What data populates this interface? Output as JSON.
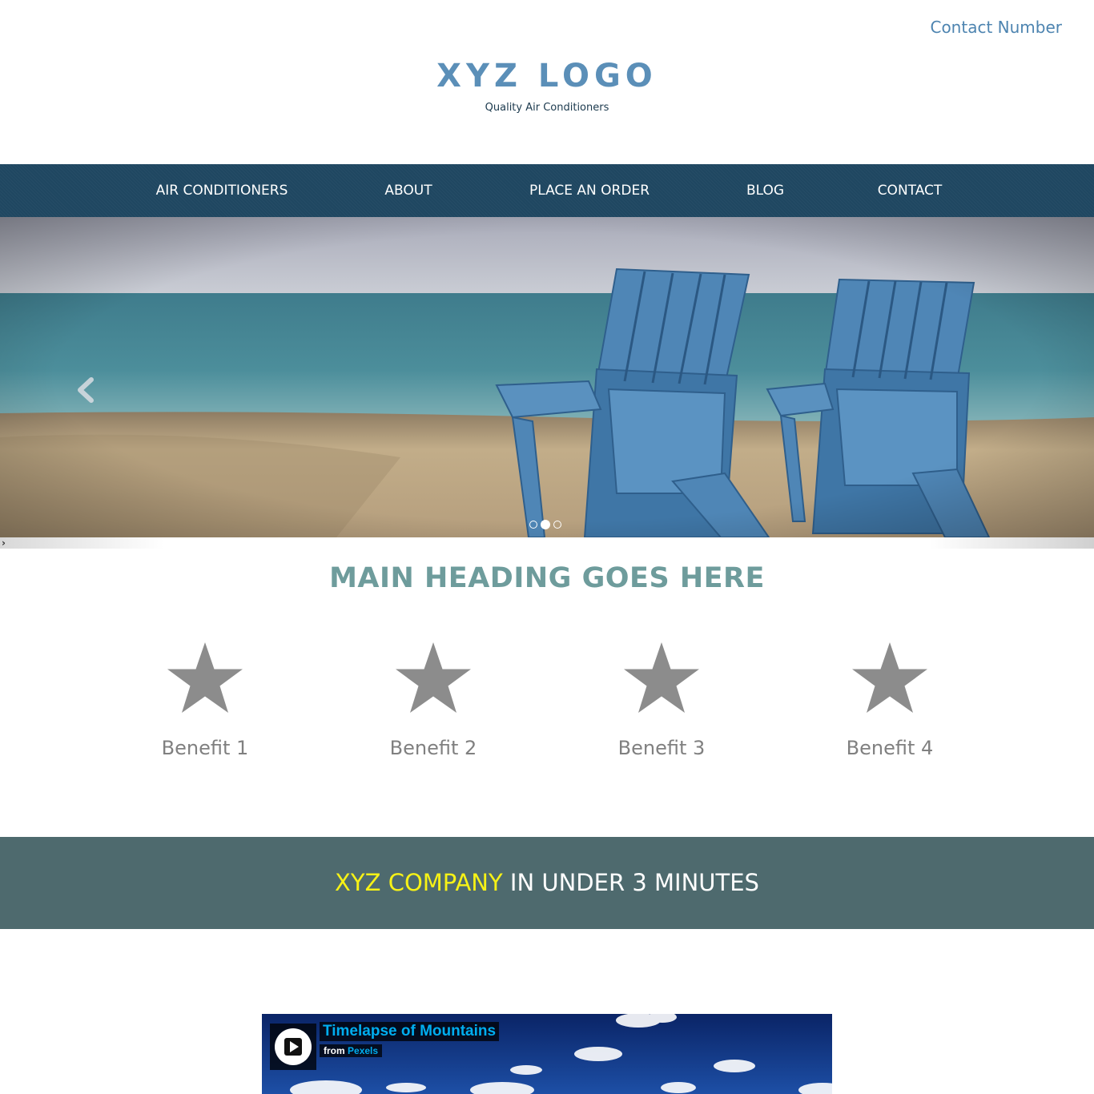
{
  "header": {
    "contact_number": "Contact Number",
    "logo": "XYZ LOGO",
    "tagline": "Quality Air Conditioners"
  },
  "nav": {
    "items": [
      "AIR CONDITIONERS",
      "ABOUT",
      "PLACE AN ORDER",
      "BLOG",
      "CONTACT"
    ]
  },
  "slider": {
    "slide_count": 3,
    "active_index": 1,
    "prev_icon": "chevron-left-icon",
    "next_icon": "chevron-right-icon"
  },
  "main": {
    "heading": "MAIN HEADING GOES HERE",
    "benefits": [
      {
        "label": "Benefit 1",
        "icon": "star-icon"
      },
      {
        "label": "Benefit 2",
        "icon": "star-icon"
      },
      {
        "label": "Benefit 3",
        "icon": "star-icon"
      },
      {
        "label": "Benefit 4",
        "icon": "star-icon"
      }
    ]
  },
  "band": {
    "accent_text": "XYZ COMPANY",
    "rest_text": " IN UNDER 3 MINUTES"
  },
  "video": {
    "title": "Timelapse of Mountains",
    "from_label": "from",
    "source": "Pexels"
  },
  "colors": {
    "nav_bg": "#1f4761",
    "accent_yellow": "#f7f216",
    "heading_teal": "#6e9c9c",
    "band_bg": "#4e6a6e",
    "logo_blue": "#5b8fb8"
  }
}
